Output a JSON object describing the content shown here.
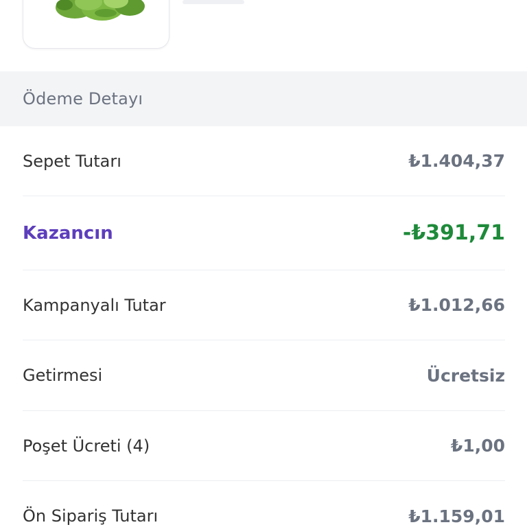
{
  "product": {
    "image_icon": "green-pepper-image"
  },
  "payment_detail": {
    "title": "Ödeme Detayı",
    "rows": [
      {
        "label": "Sepet Tutarı",
        "value": "₺1.404,37"
      },
      {
        "label": "Kazancın",
        "value": "-₺391,71"
      },
      {
        "label": "Kampanyalı Tutar",
        "value": "₺1.012,66"
      },
      {
        "label": "Getirmesi",
        "value": "Ücretsiz"
      },
      {
        "label": "Poşet Ücreti (4)",
        "value": "₺1,00"
      },
      {
        "label": "Ön Sipariş Tutarı",
        "value": "₺1.159,01"
      }
    ]
  },
  "colors": {
    "accent_purple": "#5d3ebc",
    "savings_green": "#1e8a3a",
    "muted_gray": "#6b7280",
    "section_bg": "#f3f4f6"
  }
}
